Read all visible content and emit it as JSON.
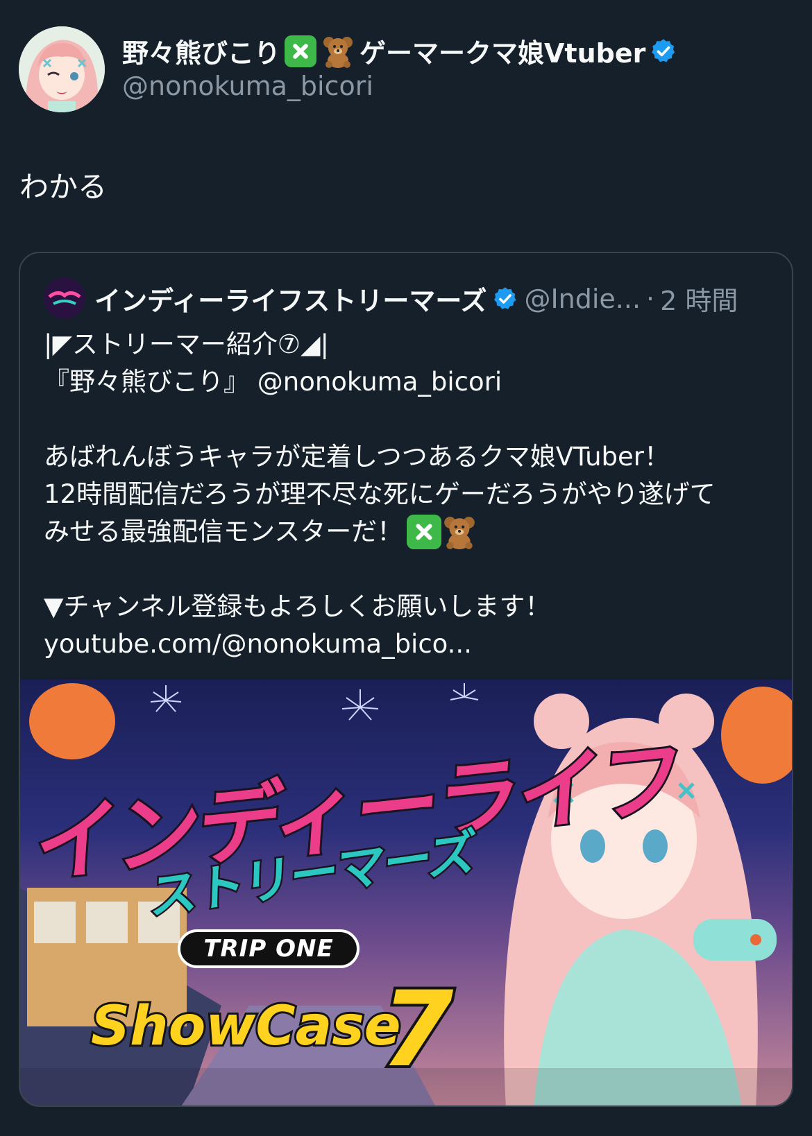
{
  "author": {
    "display_name": "野々熊びこり",
    "display_name_suffix": "ゲーマークマ娘Vtuber",
    "handle": "@nonokuma_bicori",
    "verified": true,
    "avatar_icon": "girl-avatar-icon"
  },
  "tweet": {
    "text": "わかる"
  },
  "quoted": {
    "display_name": "インディーライフストリーマーズ",
    "handle": "@Indie...",
    "separator": "·",
    "time": "2 時間",
    "lines": [
      "|◤ストリーマー紹介⑦◢|",
      "『野々熊びこり』 @nonokuma_bicori",
      "",
      "あばれんぼうキャラが定着しつつあるクマ娘VTuber！",
      "12時間配信だろうが理不尽な死にゲーだろうがやり遂げて",
      "みせる最強配信モンスターだ！",
      "",
      "▼チャンネル登録もよろしくお願いします！",
      "youtube.com/@nonokuma_bico..."
    ],
    "image": {
      "title": "インディーライフ",
      "subtitle": "ストリーマーズ",
      "badge": "TRIP ONE",
      "showcase": "ShowCase",
      "number": "7"
    }
  },
  "colors": {
    "background": "#15202b",
    "secondary_text": "#8b98a5",
    "verified_blue": "#1d9bf0",
    "border": "#38444d"
  }
}
